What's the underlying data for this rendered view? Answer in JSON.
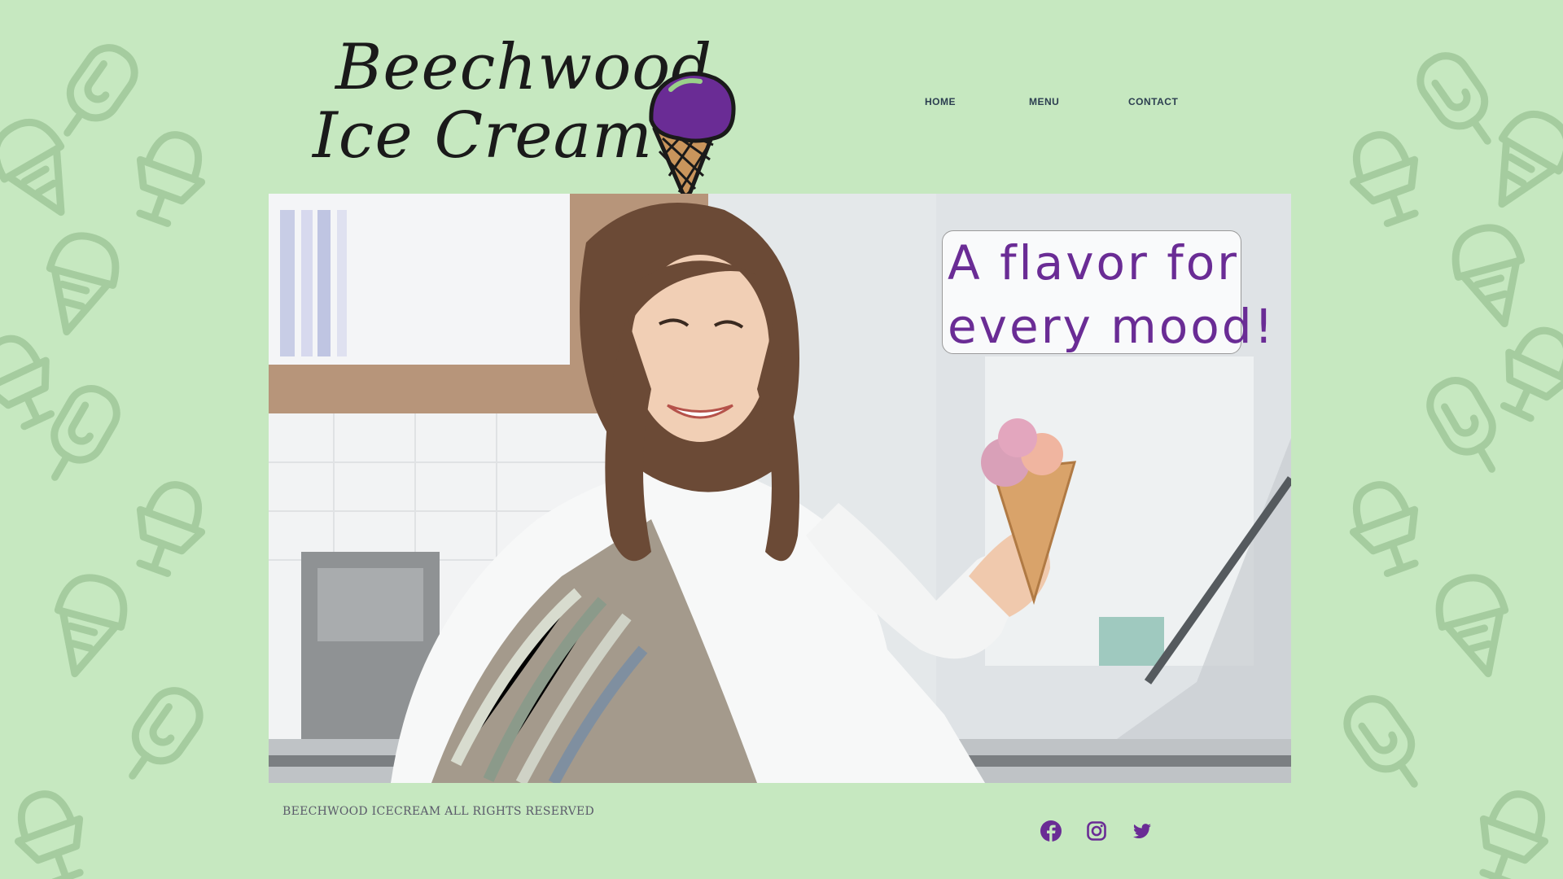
{
  "logo": {
    "line1": "Beechwood",
    "line2": "Ice Cream",
    "cone_scoop_color": "#6a2c95",
    "cone_color": "#c9955c"
  },
  "nav": {
    "items": [
      {
        "label": "HOME"
      },
      {
        "label": "MENU"
      },
      {
        "label": "CONTACT"
      }
    ]
  },
  "hero": {
    "image_subject": "smiling woman in striped apron holding ice cream cone",
    "tagline_line1": "A flavor for",
    "tagline_line2": "every mood!"
  },
  "footer": {
    "copyright": "BEECHWOOD ICECREAM ALL RIGHTS RESERVED",
    "social": [
      {
        "icon": "facebook-icon"
      },
      {
        "icon": "instagram-icon"
      },
      {
        "icon": "twitter-icon"
      }
    ]
  },
  "colors": {
    "background": "#c6e8c0",
    "pattern": "#a8cfa2",
    "accent_purple": "#6a2c95",
    "nav_text": "#2c3e50"
  }
}
